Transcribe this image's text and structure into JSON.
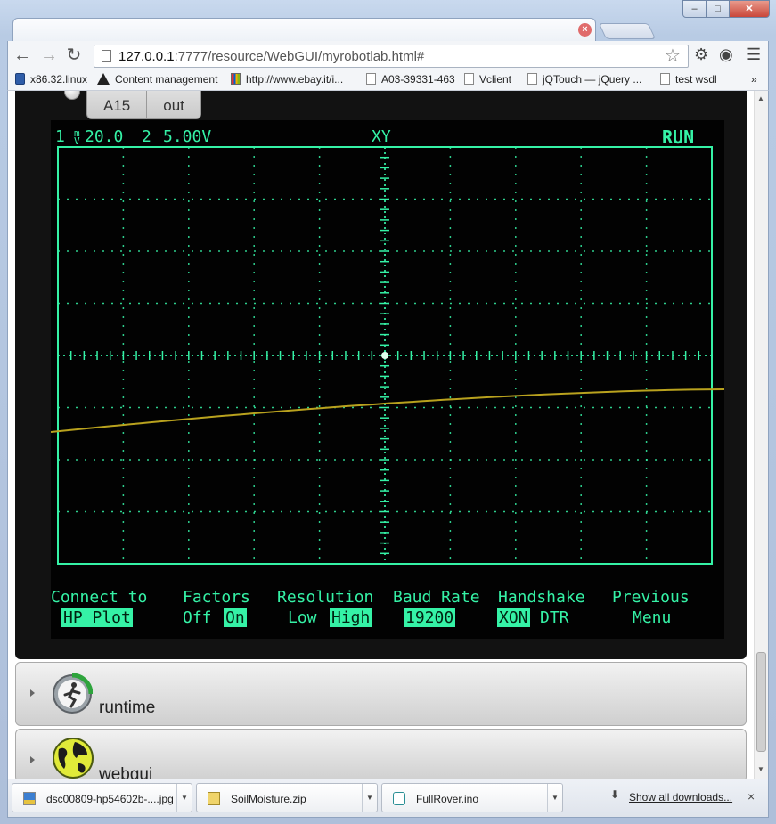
{
  "browser": {
    "address": {
      "host": "127.0.0.1",
      "rest": ":7777/resource/WebGUI/myrobotlab.html#"
    },
    "window_controls": {
      "minimize": "–",
      "maximize": "□",
      "close": "✕"
    },
    "tab_close": "×"
  },
  "bookmarks": [
    {
      "label": "x86.32.linux",
      "icon": "blue-badge-icon"
    },
    {
      "label": "Content management",
      "icon": "triangle-logo-icon"
    },
    {
      "label": "http://www.ebay.it/i...",
      "icon": "ebay-icon"
    },
    {
      "label": "A03-39331-463",
      "icon": "page-icon"
    },
    {
      "label": "Vclient",
      "icon": "page-icon"
    },
    {
      "label": "jQTouch — jQuery ...",
      "icon": "page-icon"
    },
    {
      "label": "test wsdl",
      "icon": "page-icon"
    }
  ],
  "bookmarks_overflow": "»",
  "pin_buttons": {
    "a": "A15",
    "b": "out"
  },
  "scope": {
    "ch1": "1",
    "ch1_scale": "20.0",
    "ch1_unit_top": "m",
    "ch1_unit_bottom": "V",
    "ch2": "2",
    "ch2_scale": "5.00V",
    "mode": "XY",
    "status": "RUN",
    "menu": {
      "connect_title": "Connect to",
      "connect_value": "HP Plot",
      "factors_title": "Factors",
      "factors_off": "Off",
      "factors_on": "On",
      "resolution_title": "Resolution",
      "resolution_low": "Low",
      "resolution_high": "High",
      "baud_title": "Baud Rate",
      "baud_value": "19200",
      "handshake_title": "Handshake",
      "handshake_xon": "XON",
      "handshake_dtr": "DTR",
      "previous_title": "Previous",
      "previous_sub": "Menu"
    },
    "colors": {
      "phosphor": "#35f2a6",
      "trace": "#b9a21e"
    }
  },
  "services": [
    {
      "label": "runtime",
      "icon": "runtime-icon"
    },
    {
      "label": "webgui",
      "icon": "webgui-globe-icon"
    }
  ],
  "downloads": {
    "items": [
      {
        "name": "dsc00809-hp54602b-....jpg",
        "icon": "image-file-icon"
      },
      {
        "name": "SoilMoisture.zip",
        "icon": "zip-file-icon"
      },
      {
        "name": "FullRover.ino",
        "icon": "arduino-file-icon"
      }
    ],
    "show_all": "Show all downloads...",
    "close": "×"
  }
}
